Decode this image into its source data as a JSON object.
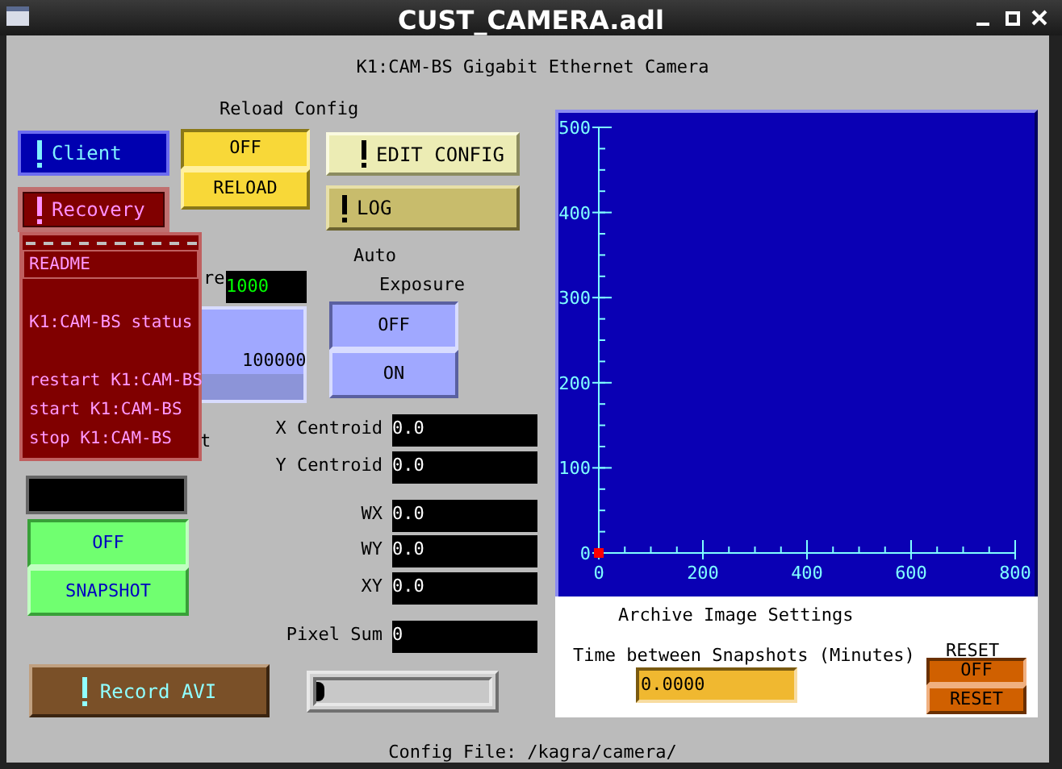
{
  "window": {
    "title": "CUST_CAMERA.adl"
  },
  "heading": "K1:CAM-BS Gigabit Ethernet Camera",
  "reload_config": {
    "label": "Reload Config",
    "choices": [
      {
        "label": "OFF",
        "selected": true
      },
      {
        "label": "RELOAD",
        "selected": false
      }
    ]
  },
  "related_displays": [
    {
      "label": "Client",
      "expanded": false
    },
    {
      "label": "EDIT CONFIG",
      "expanded": false
    },
    {
      "label": "Recovery",
      "expanded": true
    },
    {
      "label": "LOG",
      "expanded": false
    }
  ],
  "recovery_menu": [
    {
      "kind": "entry",
      "label": "README",
      "selected": true
    },
    {
      "kind": "spacer"
    },
    {
      "kind": "entry",
      "label": "K1:CAM-BS status",
      "selected": false
    },
    {
      "kind": "spacer"
    },
    {
      "kind": "entry",
      "label": "restart K1:CAM-BS",
      "selected": false
    },
    {
      "kind": "entry",
      "label": "start K1:CAM-BS",
      "selected": false
    },
    {
      "kind": "entry",
      "label": "stop K1:CAM-BS",
      "selected": false
    }
  ],
  "obscured_widgets": {
    "text_1": "re",
    "field_1": "1000",
    "text_2": "100000",
    "text_3": "t"
  },
  "auto_exposure": {
    "label_1": "Auto",
    "label_2": "Exposure",
    "choices": [
      {
        "label": "OFF",
        "selected": true
      },
      {
        "label": "ON",
        "selected": false
      }
    ]
  },
  "readouts": [
    {
      "label": "X Centroid",
      "value": "0.0"
    },
    {
      "label": "Y Centroid",
      "value": "0.0"
    },
    {
      "label": "WX",
      "value": "0.0"
    },
    {
      "label": "WY",
      "value": "0.0"
    },
    {
      "label": "XY",
      "value": "0.0"
    },
    {
      "label": "Pixel Sum",
      "value": "0"
    }
  ],
  "snapshot": {
    "choices": [
      {
        "label": "OFF",
        "selected": true
      },
      {
        "label": "SNAPSHOT",
        "selected": false
      }
    ]
  },
  "record_avi": {
    "label": "Record AVI"
  },
  "bar_monitor": {
    "level": 0
  },
  "plot": {
    "chart_data": {
      "type": "scatter",
      "xlim": [
        0,
        800
      ],
      "ylim": [
        0,
        500
      ],
      "xticks": [
        0,
        200,
        400,
        600,
        800
      ],
      "yticks": [
        0,
        100,
        200,
        300,
        400,
        500
      ],
      "series": [
        {
          "color": "#ff0000",
          "x": [
            0
          ],
          "values": [
            0
          ]
        }
      ]
    }
  },
  "archive": {
    "title": "Archive Image Settings",
    "interval_label": "Time between Snapshots (Minutes)",
    "interval_value": "0.0000",
    "reset_label": "RESET",
    "reset_choices": [
      {
        "label": "OFF",
        "selected": true
      },
      {
        "label": "RESET",
        "selected": false
      }
    ]
  },
  "footer": "Config File: /kagra/camera/"
}
